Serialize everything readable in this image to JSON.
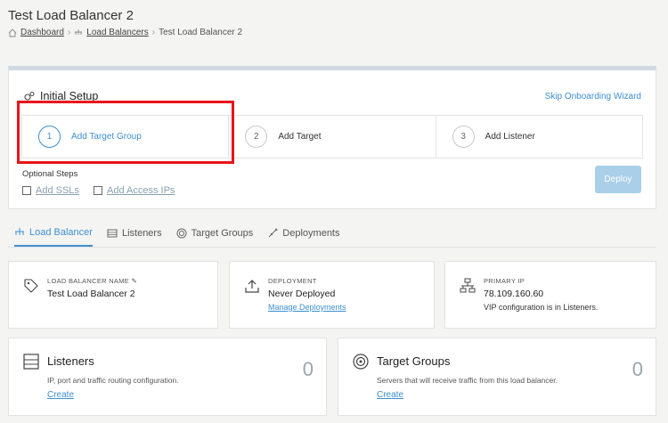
{
  "page": {
    "title": "Test Load Balancer 2",
    "breadcrumb": {
      "dashboard": "Dashboard",
      "load_balancers": "Load Balancers",
      "current": "Test Load Balancer 2"
    }
  },
  "setup": {
    "title": "Initial Setup",
    "skip": "Skip Onboarding Wizard",
    "steps": [
      {
        "num": "1",
        "label": "Add Target Group",
        "active": true
      },
      {
        "num": "2",
        "label": "Add Target"
      },
      {
        "num": "3",
        "label": "Add Listener"
      }
    ],
    "optional_title": "Optional Steps",
    "optional": [
      "Add SSLs",
      "Add Access IPs"
    ],
    "deploy": "Deploy"
  },
  "tabs": [
    "Load Balancer",
    "Listeners",
    "Target Groups",
    "Deployments"
  ],
  "cards": {
    "name": {
      "label": "LOAD BALANCER NAME",
      "value": "Test Load Balancer 2"
    },
    "deployment": {
      "label": "DEPLOYMENT",
      "value": "Never Deployed",
      "link": "Manage Deployments"
    },
    "ip": {
      "label": "PRIMARY IP",
      "value": "78.109.160.60",
      "note": "VIP configuration is in Listeners."
    }
  },
  "panels": {
    "listeners": {
      "title": "Listeners",
      "desc": "IP, port and traffic routing configuration.",
      "link": "Create",
      "count": "0"
    },
    "targets": {
      "title": "Target Groups",
      "desc": "Servers that will receive traffic from this load balancer.",
      "link": "Create",
      "count": "0"
    }
  },
  "colors": {
    "accent": "#3d8fd2",
    "highlight": "#e8141c",
    "deploy_disabled": "#a9cfe9"
  }
}
